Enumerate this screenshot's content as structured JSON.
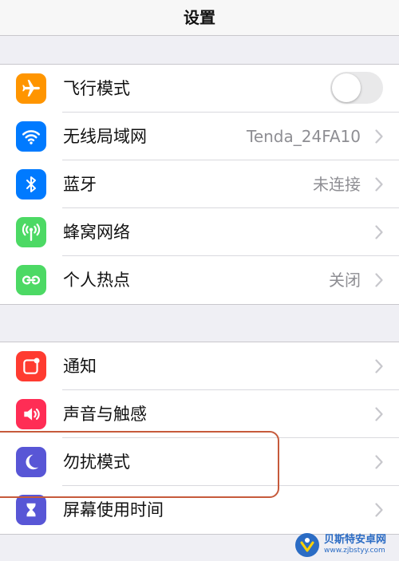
{
  "navbar": {
    "title": "设置"
  },
  "groups": [
    {
      "items": [
        {
          "label": "飞行模式",
          "icon": "airplane-icon",
          "color": "#ff9500",
          "toggle": false
        },
        {
          "label": "无线局域网",
          "icon": "wifi-icon",
          "color": "#007aff",
          "value": "Tenda_24FA10"
        },
        {
          "label": "蓝牙",
          "icon": "bluetooth-icon",
          "color": "#007aff",
          "value": "未连接"
        },
        {
          "label": "蜂窝网络",
          "icon": "cellular-icon",
          "color": "#4cd964",
          "value": ""
        },
        {
          "label": "个人热点",
          "icon": "hotspot-icon",
          "color": "#4cd964",
          "value": "关闭"
        }
      ]
    },
    {
      "items": [
        {
          "label": "通知",
          "icon": "notifications-icon",
          "color": "#ff3b30"
        },
        {
          "label": "声音与触感",
          "icon": "sound-icon",
          "color": "#ff2d55"
        },
        {
          "label": "勿扰模式",
          "icon": "moon-icon",
          "color": "#5856d6"
        },
        {
          "label": "屏幕使用时间",
          "icon": "hourglass-icon",
          "color": "#5856d6"
        }
      ]
    }
  ],
  "watermark": {
    "name": "贝斯特安卓网",
    "url": "www.zjbstyy.com"
  }
}
